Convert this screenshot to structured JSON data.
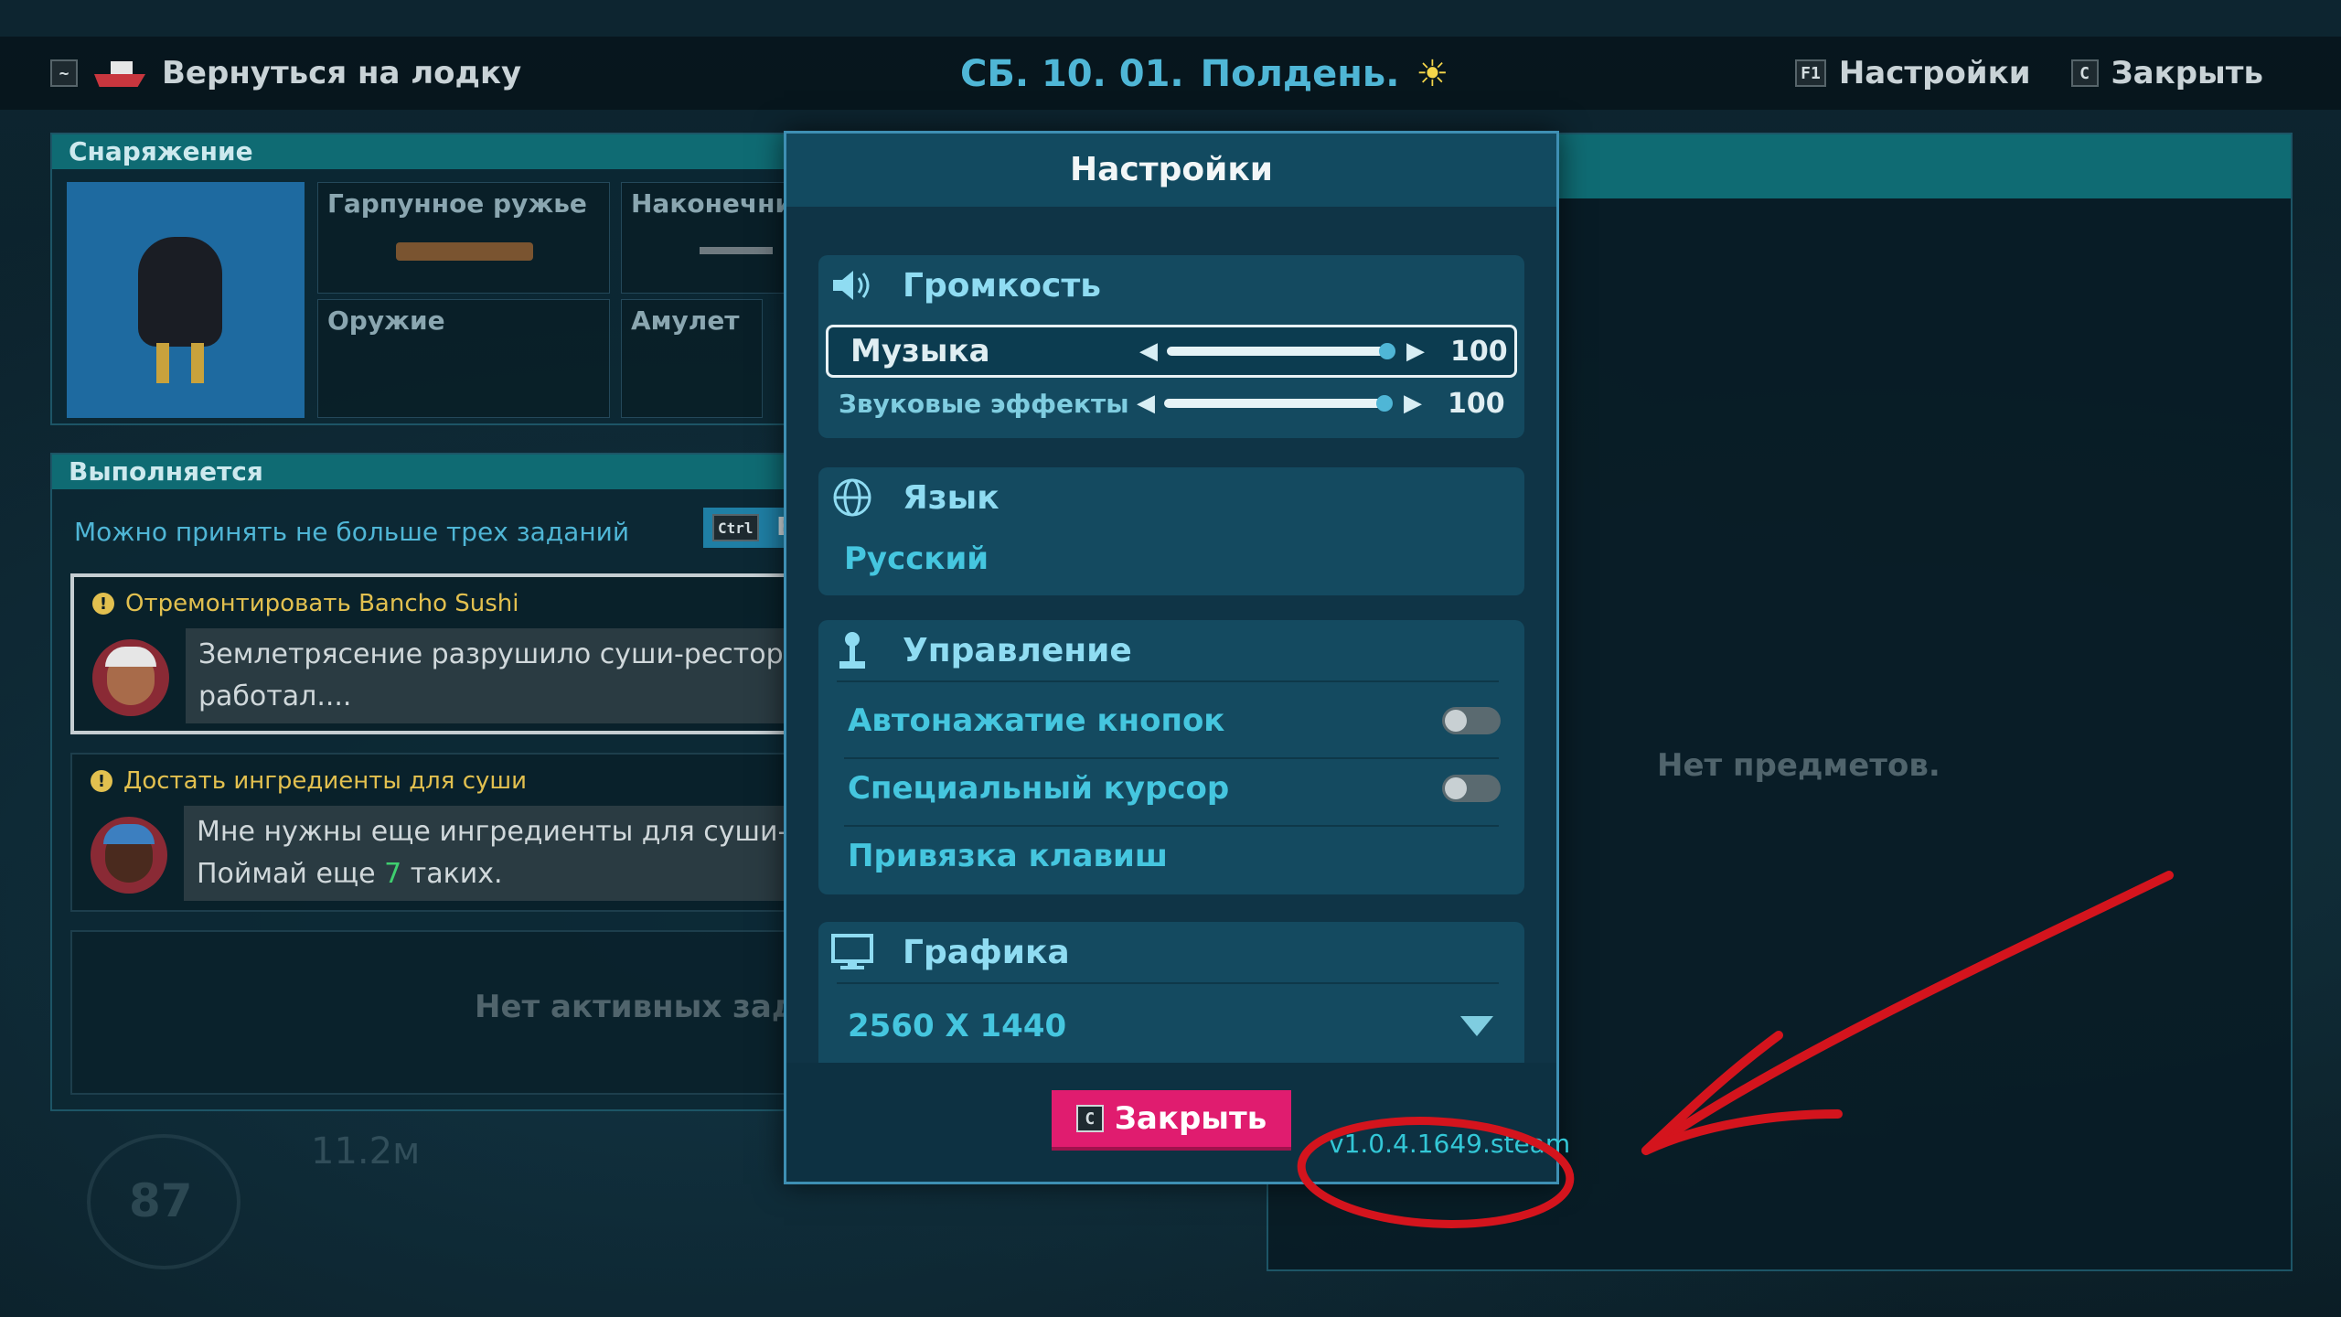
{
  "topbar": {
    "back_key": "~",
    "back_label": "Вернуться на лодку",
    "date": "СБ. 10. 01.",
    "time_of_day": "Полдень.",
    "settings_key": "F1",
    "settings_label": "Настройки",
    "close_key": "C",
    "close_label": "Закрыть"
  },
  "equipment": {
    "title": "Снаряжение",
    "slots": [
      "Гарпунное ружье",
      "Наконечник",
      "Оружие",
      "Амулет"
    ]
  },
  "quests": {
    "title": "Выполняется",
    "note": "Можно принять не больше трех заданий",
    "ctrl_key": "Ctrl",
    "ctrl_suffix": "E",
    "items": [
      {
        "title": "Отремонтировать Bancho Sushi",
        "line1": "Землетрясение разрушило суши-ресторан",
        "line2": "работал...."
      },
      {
        "title": "Достать ингредиенты для суши",
        "line1": "Мне нужны еще ингредиенты для суши-ба",
        "line2_pre": "Поймай еще ",
        "line2_num": "7",
        "line2_post": " таких."
      }
    ],
    "empty": "Нет активных задан"
  },
  "inventory": {
    "empty": "Нет предметов."
  },
  "hud": {
    "depth": "87",
    "distance": "11.2м"
  },
  "settings": {
    "title": "Настройки",
    "volume": {
      "header": "Громкость",
      "music_label": "Музыка",
      "music_value": "100",
      "music_level": 1.0,
      "sfx_label": "Звуковые эффекты",
      "sfx_value": "100",
      "sfx_level": 1.0
    },
    "language": {
      "header": "Язык",
      "value": "Русский"
    },
    "controls": {
      "header": "Управление",
      "auto_press": "Автонажатие кнопок",
      "auto_press_on": false,
      "special_cursor": "Специальный курсор",
      "special_cursor_on": false,
      "keybinds": "Привязка клавиш"
    },
    "graphics": {
      "header": "Графика",
      "resolution": "2560 X 1440"
    },
    "close_key": "C",
    "close_label": "Закрыть",
    "version": "v1.0.4.1649.steam"
  },
  "colors": {
    "accent": "#4fb6d6",
    "close_button": "#e01c6f",
    "annotation": "#d4141d",
    "quest_title": "#e2c04f"
  }
}
